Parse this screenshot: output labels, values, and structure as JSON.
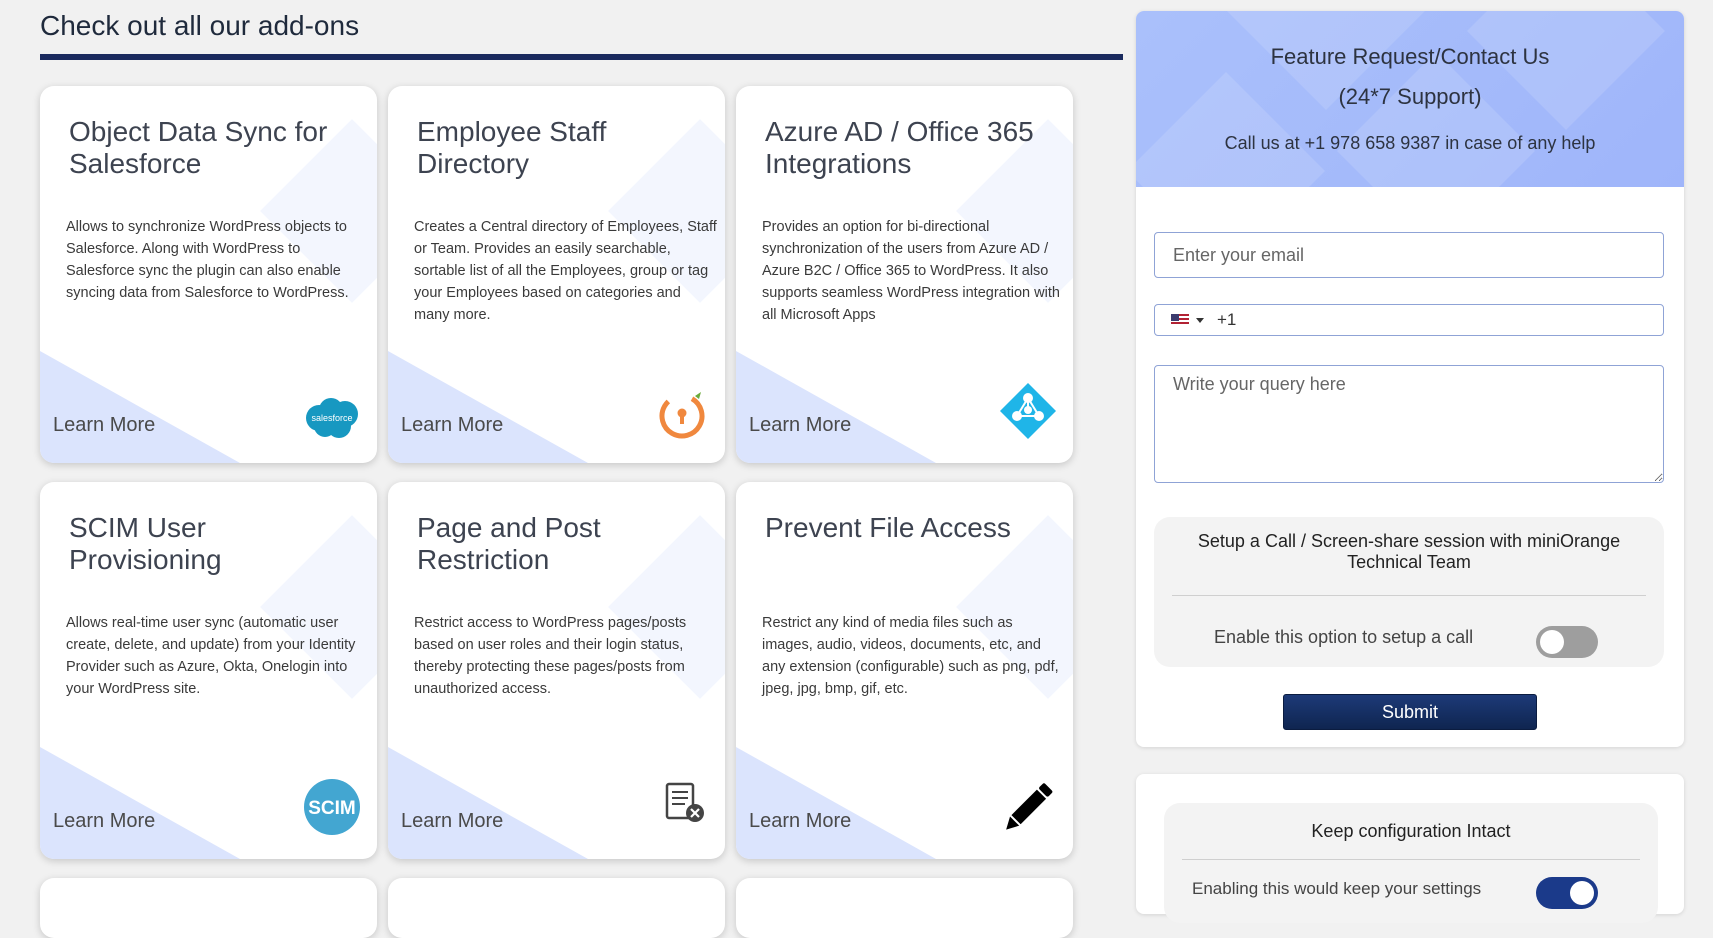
{
  "page": {
    "heading": "Check out all our add-ons"
  },
  "cards": [
    {
      "title": "Object Data Sync for Salesforce",
      "description": "Allows to synchronize WordPress objects to Salesforce. Along with WordPress to Salesforce sync the plugin can also enable syncing data from Salesforce to WordPress.",
      "link": "Learn More",
      "icon": "salesforce-icon",
      "icon_text": "salesforce"
    },
    {
      "title": "Employee Staff Directory",
      "description": "Creates a Central directory of Employees, Staff or Team. Provides an easily searchable, sortable list of all the Employees, group or tag your Employees based on categories and many more.",
      "link": "Learn More",
      "icon": "staff-directory-icon"
    },
    {
      "title": "Azure AD / Office 365 Integrations",
      "description": "Provides an option for bi-directional synchronization of the users from Azure AD / Azure B2C / Office 365 to WordPress. It also supports seamless WordPress integration with all Microsoft Apps",
      "link": "Learn More",
      "icon": "azure-ad-icon"
    },
    {
      "title": "SCIM User Provisioning",
      "description": "Allows real-time user sync (automatic user create, delete, and update) from your Identity Provider such as Azure, Okta, Onelogin into your WordPress site.",
      "link": "Learn More",
      "icon": "scim-icon",
      "icon_text": "SCIM"
    },
    {
      "title": "Page and Post Restriction",
      "description": "Restrict access to WordPress pages/posts based on user roles and their login status, thereby protecting these pages/posts from unauthorized access.",
      "link": "Learn More",
      "icon": "document-restricted-icon"
    },
    {
      "title": "Prevent File Access",
      "description": "Restrict any kind of media files such as images, audio, videos, documents, etc, and any extension (configurable) such as png, pdf, jpeg, jpg, bmp, gif, etc.",
      "link": "Learn More",
      "icon": "pencil-icon"
    }
  ],
  "contact": {
    "title_line1": "Feature Request/Contact Us",
    "title_line2": "(24*7 Support)",
    "call_text": "Call us at +1 978 658 9387 in case of any help",
    "email_placeholder": "Enter your email",
    "phone_prefix": "+1",
    "query_placeholder": "Write your query here",
    "call_setup_title": "Setup a Call / Screen-share session with miniOrange Technical Team",
    "call_setup_label": "Enable this option to setup a call",
    "call_enabled": false,
    "submit_label": "Submit"
  },
  "keep_config": {
    "title": "Keep configuration Intact",
    "text": "Enabling this would keep your settings",
    "enabled": true
  },
  "colors": {
    "accent": "#1a2a5e",
    "header_bg": "#a7befb",
    "triangle": "#dbe4fd"
  }
}
